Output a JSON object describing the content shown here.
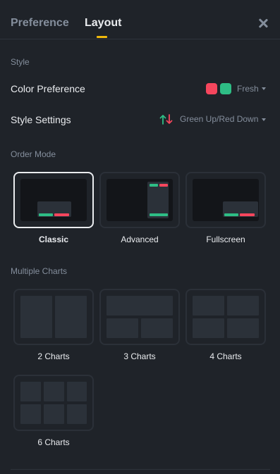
{
  "tabs": {
    "preference": "Preference",
    "layout": "Layout"
  },
  "style": {
    "section": "Style",
    "color_preference_label": "Color Preference",
    "color_preference_value": "Fresh",
    "style_settings_label": "Style Settings",
    "style_settings_value": "Green Up/Red Down"
  },
  "order_mode": {
    "section": "Order Mode",
    "options": [
      {
        "label": "Classic",
        "selected": true
      },
      {
        "label": "Advanced",
        "selected": false
      },
      {
        "label": "Fullscreen",
        "selected": false
      }
    ]
  },
  "multiple_charts": {
    "section": "Multiple Charts",
    "options": [
      {
        "label": "2 Charts"
      },
      {
        "label": "3 Charts"
      },
      {
        "label": "4 Charts"
      },
      {
        "label": "6 Charts"
      }
    ]
  },
  "colors": {
    "up": "#2ebd85",
    "down": "#f6465d",
    "accent": "#f0b90b",
    "background": "#1f2329"
  },
  "icons": {
    "close": "close-icon",
    "up_down": "arrow-up-down-icon",
    "caret": "caret-down-icon"
  }
}
